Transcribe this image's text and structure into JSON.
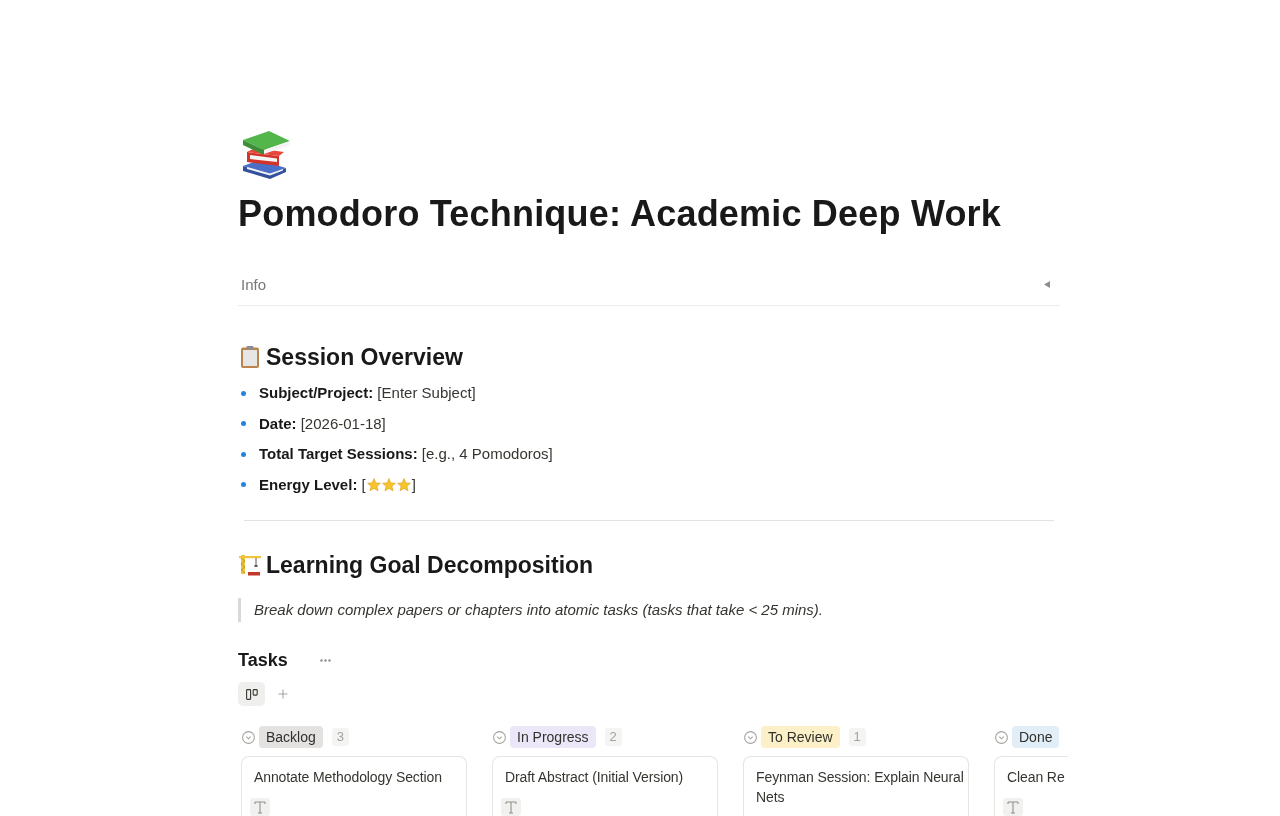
{
  "page": {
    "title": "Pomodoro Technique: Academic Deep Work"
  },
  "info_toggle": {
    "label": "Info",
    "expanded": false
  },
  "session_overview": {
    "heading": "Session Overview",
    "items": [
      {
        "kind": "text",
        "text": "**Subject/Project:** [Enter Subject]"
      },
      {
        "kind": "text",
        "text": "**Date:** [2026-01-18]"
      },
      {
        "kind": "text",
        "text": "**Total Target Sessions:** [e.g., 4 Pomodoros]"
      },
      {
        "kind": "rating",
        "text": "**Energy Level:** [",
        "stars": 3,
        "after": "]"
      }
    ]
  },
  "goal_decomposition": {
    "heading": "Learning Goal Decomposition",
    "quote": "Break down complex papers or chapters into atomic tasks (tasks that take < 25 mins)."
  },
  "tasks": {
    "title": "Tasks",
    "views": [
      {
        "kind": "board",
        "selected": true
      }
    ],
    "groups": [
      {
        "name": "Backlog",
        "count": "3",
        "color": "#e3e2e0",
        "cards": [
          {
            "title": "Annotate Methodology Section",
            "properties": [
              {
                "kind": "text"
              }
            ]
          }
        ]
      },
      {
        "name": "In Progress",
        "count": "2",
        "color": "#ece7f8",
        "cards": [
          {
            "title": "Draft Abstract (Initial Version)",
            "properties": [
              {
                "kind": "text"
              }
            ]
          }
        ]
      },
      {
        "name": "To Review",
        "count": "1",
        "color": "#fbf0c8",
        "cards": [
          {
            "title": "Feynman Session: Explain Neural Nets"
          }
        ]
      },
      {
        "name": "Done",
        "color": "#e1eef8",
        "cards": [
          {
            "title": "Clean Re",
            "properties": [
              {
                "kind": "text"
              }
            ]
          }
        ]
      }
    ]
  }
}
